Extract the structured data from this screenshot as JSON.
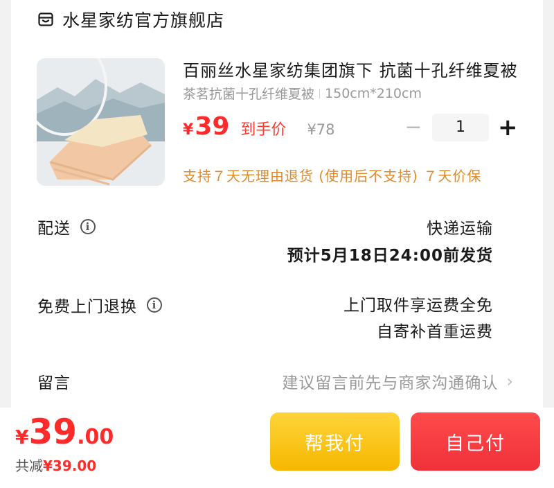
{
  "store": {
    "name": "水星家纺官方旗舰店",
    "icon": "store-icon"
  },
  "product": {
    "title": "百丽丝水星家纺集团旗下 抗菌十孔纤维夏被",
    "spec_name": "茶茗抗菌十孔纤维夏被",
    "spec_size": "150cm*210cm",
    "price_symbol": "¥",
    "price": "39",
    "price_tag": "到手价",
    "original_price": "¥78",
    "quantity": "1",
    "minus": "−",
    "plus": "+",
    "service": "支持７天无理由退货 (使用后不支持)  ７天价保"
  },
  "rows": {
    "delivery_label": "配送",
    "delivery_method": "快递运输",
    "delivery_eta": "预计5月18日24:00前发货",
    "return_label": "免费上门退换",
    "return_line1": "上门取件享运费全免",
    "return_line2": "自寄补首重运费",
    "message_label": "留言",
    "message_placeholder": "建议留言前先与商家沟通确认"
  },
  "footer": {
    "total_symbol": "¥",
    "total_int": "39",
    "total_dec": ".00",
    "discount_label": "共减",
    "discount_amount": "¥39.00",
    "help_pay": "帮我付",
    "self_pay": "自己付"
  },
  "colors": {
    "accent_red": "#ff2a2a",
    "service_orange": "#e08a2a",
    "help_button": "#f6b700",
    "self_button": "#f0303a"
  }
}
